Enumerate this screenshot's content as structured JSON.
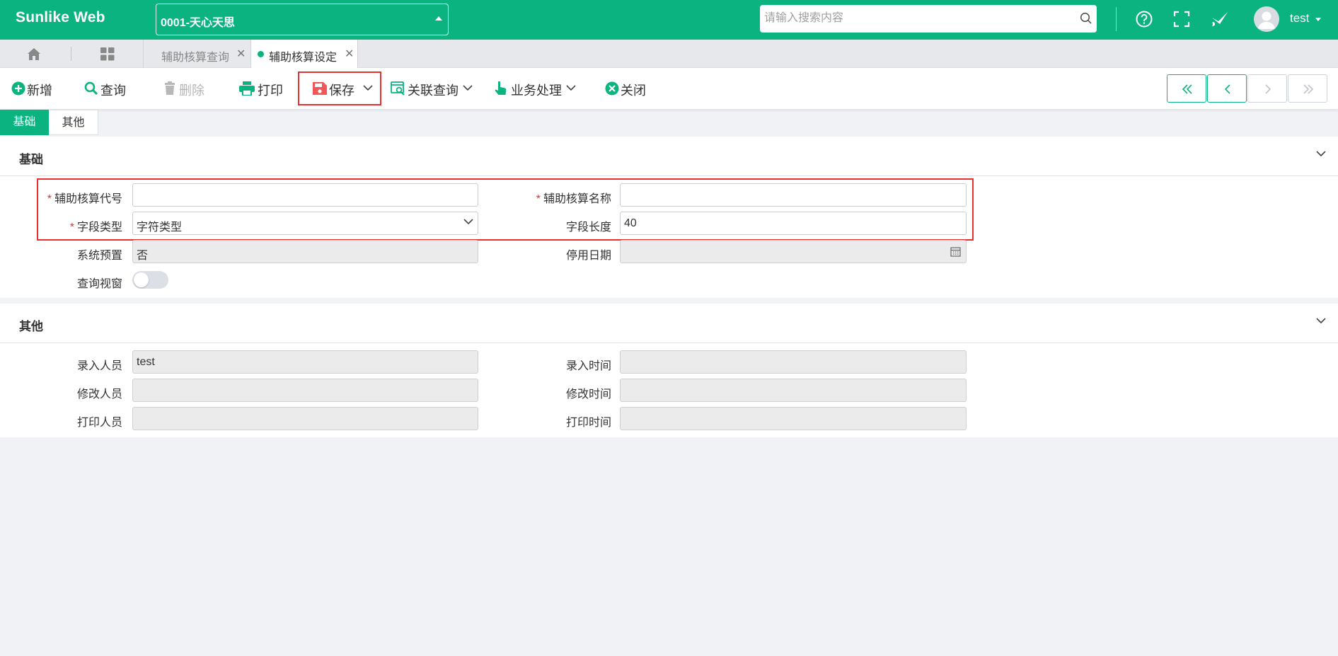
{
  "header": {
    "brand": "Sunlike Web",
    "company": "0001-天心天思",
    "search_placeholder": "请输入搜索内容",
    "user": "test"
  },
  "tabs": [
    {
      "label": "辅助核算查询",
      "active": false
    },
    {
      "label": "辅助核算设定",
      "active": true
    }
  ],
  "toolbar": {
    "add": "新增",
    "query": "查询",
    "delete": "删除",
    "print": "打印",
    "save": "保存",
    "related_query": "关联查询",
    "business": "业务处理",
    "close": "关闭"
  },
  "subtabs": [
    "基础",
    "其他"
  ],
  "basic": {
    "title": "基础",
    "code_label": "辅助核算代号",
    "code_value": "",
    "name_label": "辅助核算名称",
    "name_value": "",
    "field_type_label": "字段类型",
    "field_type_value": "字符类型",
    "field_length_label": "字段长度",
    "field_length_value": "40",
    "preset_label": "系统预置",
    "preset_value": "否",
    "stop_date_label": "停用日期",
    "stop_date_value": "",
    "query_window_label": "查询视窗",
    "query_window_on": false
  },
  "other": {
    "title": "其他",
    "entered_by_label": "录入人员",
    "entered_by_value": "test",
    "entered_time_label": "录入时间",
    "entered_time_value": "",
    "modified_by_label": "修改人员",
    "modified_by_value": "",
    "modified_time_label": "修改时间",
    "modified_time_value": "",
    "printed_by_label": "打印人员",
    "printed_by_value": "",
    "printed_time_label": "打印时间",
    "printed_time_value": ""
  },
  "colors": {
    "accent": "#0ab380",
    "highlight": "#e63030"
  }
}
